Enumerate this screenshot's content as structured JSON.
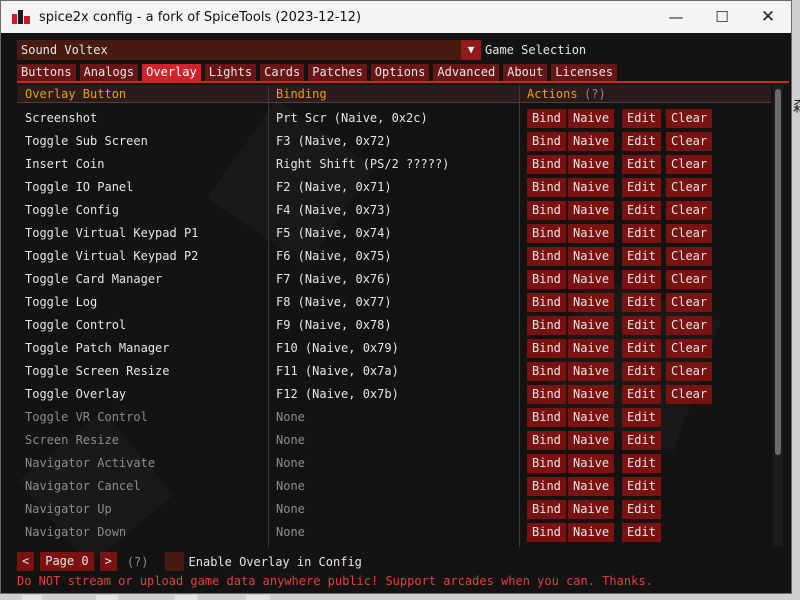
{
  "window": {
    "title": "spice2x config - a fork of SpiceTools (2023-12-12)"
  },
  "controls": {
    "minimize": "—",
    "maximize": "☐",
    "close": "✕"
  },
  "game": {
    "value": "Sound Voltex",
    "arrow": "▼",
    "label": "Game Selection"
  },
  "tabs": [
    "Buttons",
    "Analogs",
    "Overlay",
    "Lights",
    "Cards",
    "Patches",
    "Options",
    "Advanced",
    "About",
    "Licenses"
  ],
  "active_tab": "Overlay",
  "table": {
    "headers": {
      "button": "Overlay Button",
      "binding": "Binding",
      "actions": "Actions",
      "actions_help": "(?)"
    },
    "actions": {
      "bind": "Bind",
      "naive": "Naive",
      "edit": "Edit",
      "clear": "Clear"
    },
    "rows": [
      {
        "name": "Screenshot",
        "binding": "Prt Scr (Naive, 0x2c)",
        "bound": true
      },
      {
        "name": "Toggle Sub Screen",
        "binding": "F3 (Naive, 0x72)",
        "bound": true
      },
      {
        "name": "Insert Coin",
        "binding": "Right Shift (PS/2 ?????)",
        "bound": true
      },
      {
        "name": "Toggle IO Panel",
        "binding": "F2 (Naive, 0x71)",
        "bound": true
      },
      {
        "name": "Toggle Config",
        "binding": "F4 (Naive, 0x73)",
        "bound": true
      },
      {
        "name": "Toggle Virtual Keypad P1",
        "binding": "F5 (Naive, 0x74)",
        "bound": true
      },
      {
        "name": "Toggle Virtual Keypad P2",
        "binding": "F6 (Naive, 0x75)",
        "bound": true
      },
      {
        "name": "Toggle Card Manager",
        "binding": "F7 (Naive, 0x76)",
        "bound": true
      },
      {
        "name": "Toggle Log",
        "binding": "F8 (Naive, 0x77)",
        "bound": true
      },
      {
        "name": "Toggle Control",
        "binding": "F9 (Naive, 0x78)",
        "bound": true
      },
      {
        "name": "Toggle Patch Manager",
        "binding": "F10 (Naive, 0x79)",
        "bound": true
      },
      {
        "name": "Toggle Screen Resize",
        "binding": "F11 (Naive, 0x7a)",
        "bound": true
      },
      {
        "name": "Toggle Overlay",
        "binding": "F12 (Naive, 0x7b)",
        "bound": true
      },
      {
        "name": "Toggle VR Control",
        "binding": "None",
        "bound": false
      },
      {
        "name": "Screen Resize",
        "binding": "None",
        "bound": false
      },
      {
        "name": "Navigator Activate",
        "binding": "None",
        "bound": false
      },
      {
        "name": "Navigator Cancel",
        "binding": "None",
        "bound": false
      },
      {
        "name": "Navigator Up",
        "binding": "None",
        "bound": false
      },
      {
        "name": "Navigator Down",
        "binding": "None",
        "bound": false
      }
    ]
  },
  "pager": {
    "prev": "<",
    "page": "Page 0",
    "next": ">",
    "help": "(?)"
  },
  "overlay_option": {
    "label": "Enable Overlay in Config"
  },
  "warning": "Do NOT stream or upload game data anywhere public! Support arcades when you can. Thanks.",
  "outside_text": "森",
  "colors": {
    "accent": "#d0242a",
    "button_bg": "#7a1212",
    "header_text": "#e8a000",
    "warning_text": "#e53e3e"
  }
}
